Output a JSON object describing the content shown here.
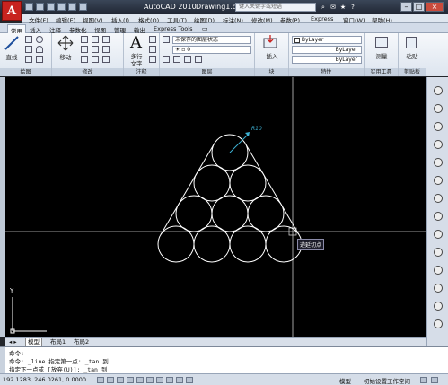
{
  "title": {
    "app": "AutoCAD 2010",
    "doc": "Drawing1.dwg",
    "search_placeholder": "键入关键字或短语"
  },
  "menu": [
    "文件(F)",
    "编辑(E)",
    "视图(V)",
    "插入(I)",
    "格式(O)",
    "工具(T)",
    "绘图(D)",
    "标注(N)",
    "修改(M)",
    "参数(P)",
    "Express",
    "窗口(W)",
    "帮助(H)"
  ],
  "ribbon_tabs": [
    "常用",
    "插入",
    "注释",
    "参数化",
    "视图",
    "管理",
    "输出",
    "Express Tools"
  ],
  "panels": {
    "draw": {
      "label": "绘图",
      "line": "直线"
    },
    "modify": {
      "label": "修改",
      "move": "移动"
    },
    "annotation": {
      "label": "注释",
      "mtext": "多行",
      "mtext2": "文字"
    },
    "layers": {
      "label": "图层",
      "state": "未保存的图层状态"
    },
    "block": {
      "label": "块",
      "insert": "插入"
    },
    "properties": {
      "label": "特性",
      "bylayer1": "ByLayer",
      "bylayer2": "ByLayer",
      "bylayer3": "ByLayer"
    },
    "utilities": {
      "label": "实用工具",
      "measure": "测量"
    },
    "clipboard": {
      "label": "剪贴板",
      "paste": "粘贴"
    }
  },
  "drawing": {
    "dimension": "R10",
    "tooltip": "递延切点"
  },
  "layout_tabs": [
    "模型",
    "布局1",
    "布局2"
  ],
  "command_lines": [
    "命令:",
    "命令: _line 指定第一点: _tan 到",
    "指定下一点或 [放弃(U)]: _tan 到"
  ],
  "status": {
    "coords": "192.1283, 246.0261, 0.0000",
    "model": "模型",
    "workspace": "初始设置工作空间"
  },
  "colors": {
    "accent": "#c8231f",
    "viewport_bg": "#000000",
    "tooltip_bg": "#1b1b28",
    "dimension": "#3db1d4"
  }
}
